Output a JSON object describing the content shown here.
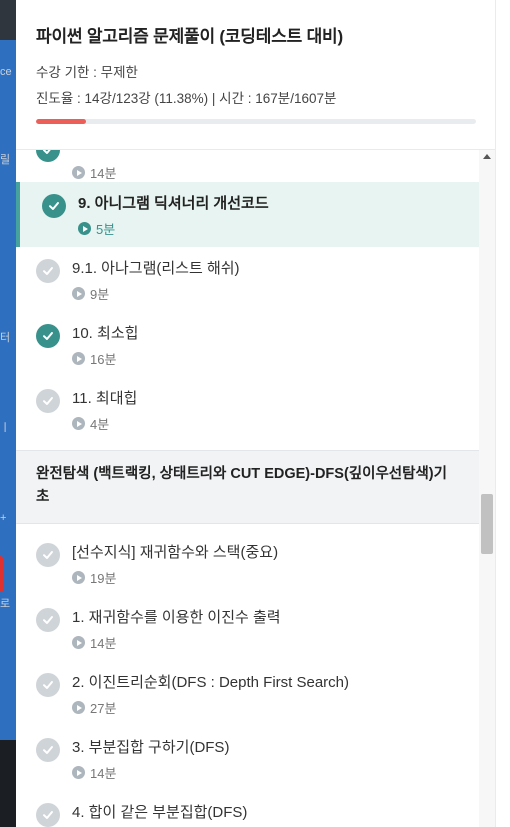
{
  "course": {
    "title": "파이썬 알고리즘 문제풀이 (코딩테스트 대비)",
    "period": "수강 기한 : 무제한",
    "progress_text": "진도율 : 14강/123강 (11.38%) | 시간 : 167분/1607분",
    "progress_fraction": 0.1138
  },
  "background_fragments": [
    "ce",
    "릴",
    "터",
    "ㅣ",
    "+",
    "로"
  ],
  "lectures_top": [
    {
      "title": "",
      "duration": "14분",
      "done": true,
      "active": false
    },
    {
      "title": "9. 아니그램 딕셔너리 개선코드",
      "duration": "5분",
      "done": true,
      "active": true
    },
    {
      "title": "9.1. 아나그램(리스트 해쉬)",
      "duration": "9분",
      "done": false,
      "active": false
    },
    {
      "title": "10. 최소힙",
      "duration": "16분",
      "done": true,
      "active": false
    },
    {
      "title": "11. 최대힙",
      "duration": "4분",
      "done": false,
      "active": false
    }
  ],
  "section": {
    "title": "완전탐색 (백트랙킹, 상태트리와 CUT EDGE)-DFS(깊이우선탐색)기초"
  },
  "lectures_bottom": [
    {
      "title": "[선수지식] 재귀함수와 스택(중요)",
      "duration": "19분",
      "done": false
    },
    {
      "title": "1. 재귀함수를 이용한 이진수 출력",
      "duration": "14분",
      "done": false
    },
    {
      "title": "2. 이진트리순회(DFS : Depth First Search)",
      "duration": "27분",
      "done": false
    },
    {
      "title": "3. 부분집합 구하기(DFS)",
      "duration": "14분",
      "done": false
    },
    {
      "title": "4. 합이 같은 부분집합(DFS)",
      "duration": "",
      "done": false
    }
  ],
  "colors": {
    "accent": "#39918c",
    "progress": "#ec5f59",
    "active_bg": "#e7f4f1"
  }
}
